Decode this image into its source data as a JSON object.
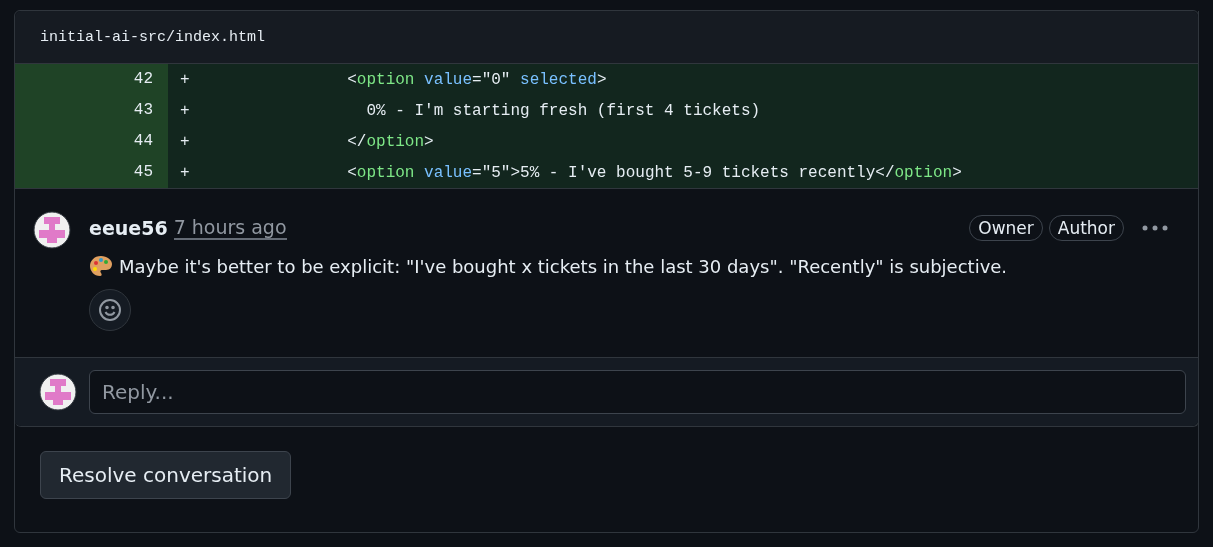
{
  "file": {
    "path": "initial-ai-src/index.html"
  },
  "diff_lines": [
    {
      "number": "42",
      "marker": "+",
      "tokens": [
        {
          "kind": "plain",
          "text": "            <"
        },
        {
          "kind": "tag",
          "text": "option"
        },
        {
          "kind": "attr",
          "text": " value"
        },
        {
          "kind": "plain",
          "text": "=\"0\" "
        },
        {
          "kind": "attr",
          "text": "selected"
        },
        {
          "kind": "plain",
          "text": ">"
        }
      ]
    },
    {
      "number": "43",
      "marker": "+",
      "tokens": [
        {
          "kind": "plain",
          "text": "              0% - I'm starting fresh (first 4 tickets)"
        }
      ]
    },
    {
      "number": "44",
      "marker": "+",
      "tokens": [
        {
          "kind": "plain",
          "text": "            </"
        },
        {
          "kind": "tag",
          "text": "option"
        },
        {
          "kind": "plain",
          "text": ">"
        }
      ]
    },
    {
      "number": "45",
      "marker": "+",
      "tokens": [
        {
          "kind": "plain",
          "text": "            <"
        },
        {
          "kind": "tag",
          "text": "option"
        },
        {
          "kind": "attr",
          "text": " value"
        },
        {
          "kind": "plain",
          "text": "=\"5\">5% - I've bought 5-9 tickets recently</"
        },
        {
          "kind": "tag",
          "text": "option"
        },
        {
          "kind": "plain",
          "text": ">"
        }
      ]
    }
  ],
  "comment": {
    "author": "eeue56",
    "time": "7 hours ago",
    "badges": [
      "Owner",
      "Author"
    ],
    "body": "Maybe it's better to be explicit: \"I've bought x tickets in the last 30 days\". \"Recently\" is subjective."
  },
  "reply": {
    "placeholder": "Reply..."
  },
  "resolve_button": "Resolve conversation"
}
